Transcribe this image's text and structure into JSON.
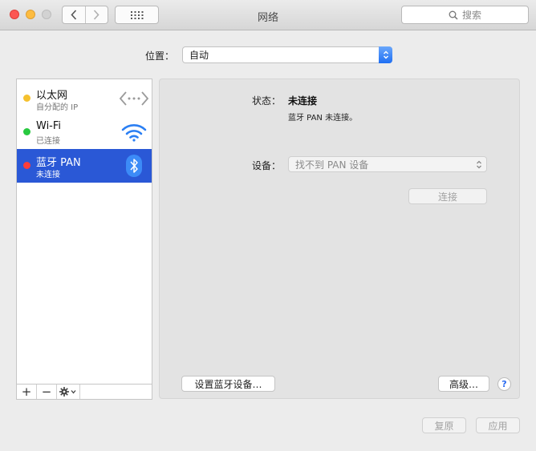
{
  "window": {
    "title": "网络"
  },
  "toolbar": {
    "search_placeholder": "搜索"
  },
  "location": {
    "label": "位置：",
    "value": "自动"
  },
  "services": [
    {
      "name": "以太网",
      "status": "自分配的 IP",
      "status_color": "#f5c12e",
      "icon": "ethernet-icon"
    },
    {
      "name": "Wi-Fi",
      "status": "已连接",
      "status_color": "#28c940",
      "icon": "wifi-icon"
    },
    {
      "name": "蓝牙 PAN",
      "status": "未连接",
      "status_color": "#fc3d39",
      "icon": "bluetooth-icon",
      "selected": true
    }
  ],
  "sidebar_tools": {
    "add": "+",
    "remove": "−"
  },
  "detail": {
    "status_label": "状态：",
    "status_value": "未连接",
    "status_description": "蓝牙 PAN 未连接。",
    "device_label": "设备：",
    "device_value": "找不到 PAN 设备",
    "connect_label": "连接",
    "setup_bluetooth_label": "设置蓝牙设备…",
    "advanced_label": "高级…",
    "help_label": "?"
  },
  "footer": {
    "revert_label": "复原",
    "apply_label": "应用"
  },
  "colors": {
    "selection": "#2a58d6",
    "accent": "#1f6ff3"
  }
}
